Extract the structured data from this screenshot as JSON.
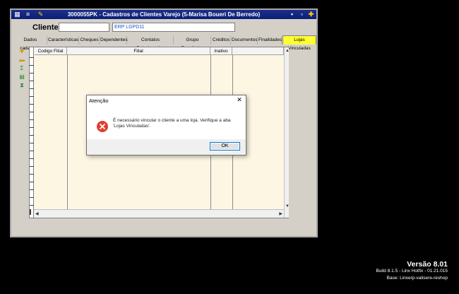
{
  "window": {
    "title": "3000055PK - Cadastros de Clientes Varejo (5-Marisa Boueri De Berredo)"
  },
  "client": {
    "label": "Cliente",
    "code_value": "",
    "tag_value": "ERP LGPD11",
    "extra_value": ""
  },
  "tabs": [
    {
      "label": "Dados cadastrais"
    },
    {
      "label": "Características"
    },
    {
      "label": "Cheques"
    },
    {
      "label": "Dependentes"
    },
    {
      "label": "Contatos Relacionados"
    },
    {
      "label": "Grupo Econômico"
    },
    {
      "label": "Créditos"
    },
    {
      "label": "Documentos"
    },
    {
      "label": "Finalidades"
    },
    {
      "label": "Lojas Vinculadas"
    }
  ],
  "grid": {
    "columns": [
      {
        "label": "Codigo Filial"
      },
      {
        "label": "Filial"
      },
      {
        "label": "Inativo"
      }
    ]
  },
  "dialog": {
    "title": "Atenção",
    "message": "É necessário vincular o cliente a uma loja. Verifique a aba 'Lojas Vinculadas'.",
    "ok_label": "OK"
  },
  "footer": {
    "version": "Versão  8.01",
    "build": "Build 8.1.5 - Linx Hotfix - 01.21.015",
    "base": "Base: Linxerp-valisere-reshop"
  },
  "colors": {
    "titlebar": "#0a246a",
    "active_tab": "#ffff33",
    "grid_bg": "#fdf6e3",
    "error": "#e33c2f"
  }
}
